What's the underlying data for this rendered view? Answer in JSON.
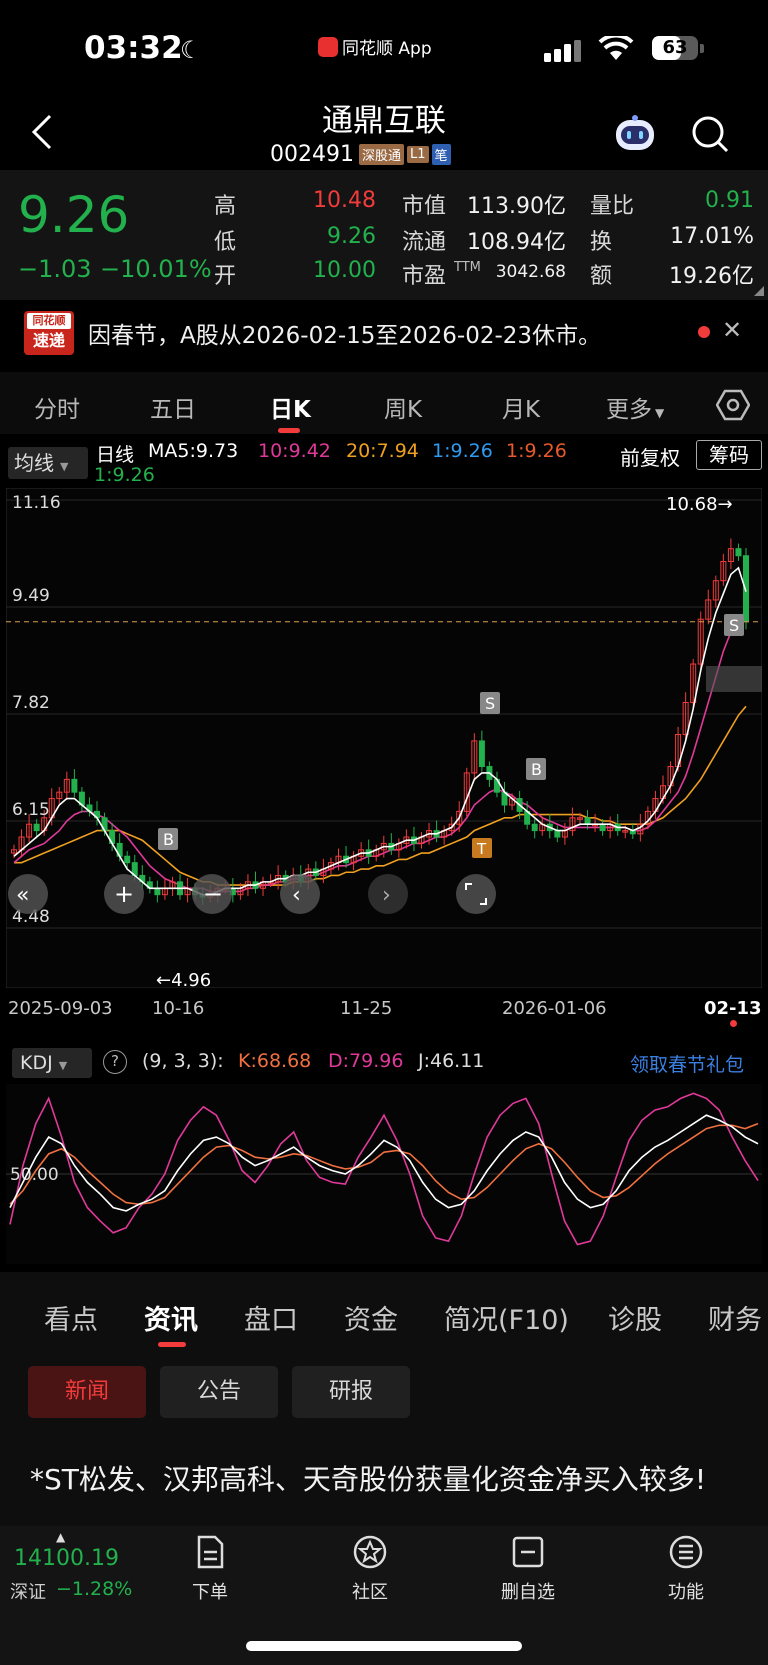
{
  "status": {
    "time": "03:32",
    "app_name": "同花顺 App",
    "battery": "63",
    "battery_level": 0.63
  },
  "nav": {
    "stock_name": "通鼎互联",
    "stock_code": "002491",
    "tags": [
      "深股通",
      "L1",
      "笔"
    ]
  },
  "quote": {
    "price": "9.26",
    "change": "−1.03",
    "change_pct": "−10.01%",
    "high_label": "高",
    "high": "10.48",
    "low_label": "低",
    "low": "9.26",
    "open_label": "开",
    "open": "10.00",
    "mcap_label": "市值",
    "mcap": "113.90亿",
    "float_label": "流通",
    "float": "108.94亿",
    "pe_label": "市盈",
    "pe_sup": "TTM",
    "pe": "3042.68",
    "volratio_label": "量比",
    "volratio": "0.91",
    "turnover_label": "换",
    "turnover": "17.01%",
    "amount_label": "额",
    "amount": "19.26亿"
  },
  "notice": {
    "logo_top": "同花顺",
    "logo_bottom": "速递",
    "text": "因春节，A股从2026-02-15至2026-02-23休市。"
  },
  "period_tabs": [
    "分时",
    "五日",
    "日K",
    "周K",
    "月K",
    "更多"
  ],
  "period_active": 2,
  "chart_header": {
    "jx": "均线",
    "day": "日线",
    "ma5": "MA5:9.73",
    "ma10": "10:9.42",
    "ma20": "20:7.94",
    "ma_a": "1:9.26",
    "ma_b": "1:9.26",
    "ma_c": "1:9.26",
    "fq": "前复权",
    "cm": "筹码"
  },
  "chart_data": [
    {
      "type": "candlestick",
      "y_ticks": [
        "11.16",
        "9.49",
        "7.82",
        "6.15",
        "4.48"
      ],
      "ylim": [
        4.48,
        11.16
      ],
      "x_ticks": [
        "2025-09-03",
        "10-16",
        "11-25",
        "2026-01-06",
        "02-13"
      ],
      "max_label": "10.68→",
      "min_label": "←4.96",
      "signal_labels": [
        "S",
        "B",
        "B",
        "S",
        "S",
        "T"
      ],
      "close": [
        5.7,
        5.9,
        6.1,
        6.0,
        6.2,
        6.5,
        6.6,
        6.8,
        6.6,
        6.4,
        6.3,
        6.2,
        6.0,
        5.8,
        5.6,
        5.5,
        5.3,
        5.2,
        5.1,
        5.0,
        5.1,
        5.2,
        5.0,
        5.1,
        5.0,
        4.96,
        5.0,
        5.1,
        5.1,
        5.0,
        5.1,
        5.2,
        5.1,
        5.2,
        5.2,
        5.3,
        5.2,
        5.3,
        5.2,
        5.4,
        5.3,
        5.4,
        5.5,
        5.6,
        5.5,
        5.6,
        5.7,
        5.6,
        5.7,
        5.8,
        5.7,
        5.8,
        5.9,
        5.8,
        5.9,
        6.0,
        5.9,
        6.0,
        6.1,
        6.3,
        6.9,
        7.4,
        7.0,
        6.8,
        6.6,
        6.4,
        6.5,
        6.3,
        6.1,
        6.0,
        6.1,
        6.0,
        5.9,
        6.0,
        6.2,
        6.2,
        6.1,
        6.1,
        6.0,
        6.1,
        6.0,
        6.0,
        5.95,
        6.1,
        6.3,
        6.5,
        6.7,
        7.0,
        7.5,
        8.0,
        8.6,
        9.3,
        9.6,
        9.9,
        10.2,
        10.4,
        10.29,
        9.26
      ],
      "ma5": [
        5.6,
        5.7,
        5.8,
        5.9,
        6.0,
        6.2,
        6.4,
        6.5,
        6.5,
        6.4,
        6.3,
        6.2,
        6.0,
        5.8,
        5.6,
        5.4,
        5.3,
        5.2,
        5.1,
        5.1,
        5.1,
        5.1,
        5.1,
        5.1,
        5.05,
        5.0,
        5.0,
        5.05,
        5.1,
        5.1,
        5.1,
        5.15,
        5.15,
        5.2,
        5.2,
        5.25,
        5.25,
        5.3,
        5.3,
        5.35,
        5.35,
        5.4,
        5.45,
        5.5,
        5.55,
        5.6,
        5.65,
        5.65,
        5.7,
        5.75,
        5.75,
        5.8,
        5.85,
        5.85,
        5.9,
        5.95,
        5.95,
        6.0,
        6.05,
        6.2,
        6.5,
        6.8,
        6.9,
        6.9,
        6.8,
        6.6,
        6.5,
        6.4,
        6.3,
        6.2,
        6.1,
        6.05,
        6.0,
        6.0,
        6.05,
        6.1,
        6.1,
        6.1,
        6.1,
        6.1,
        6.05,
        6.05,
        6.0,
        6.05,
        6.15,
        6.3,
        6.5,
        6.7,
        7.0,
        7.4,
        7.9,
        8.5,
        9.0,
        9.4,
        9.7,
        10.0,
        10.1,
        9.73
      ],
      "ma10": [
        5.5,
        5.6,
        5.7,
        5.75,
        5.8,
        5.9,
        6.0,
        6.15,
        6.25,
        6.3,
        6.3,
        6.25,
        6.2,
        6.1,
        6.0,
        5.9,
        5.75,
        5.6,
        5.45,
        5.35,
        5.25,
        5.2,
        5.15,
        5.1,
        5.1,
        5.1,
        5.05,
        5.05,
        5.05,
        5.05,
        5.05,
        5.1,
        5.1,
        5.15,
        5.15,
        5.2,
        5.2,
        5.25,
        5.25,
        5.3,
        5.3,
        5.35,
        5.4,
        5.45,
        5.45,
        5.5,
        5.55,
        5.6,
        5.6,
        5.65,
        5.7,
        5.7,
        5.75,
        5.8,
        5.8,
        5.85,
        5.9,
        5.9,
        5.95,
        6.05,
        6.2,
        6.4,
        6.5,
        6.6,
        6.65,
        6.6,
        6.55,
        6.45,
        6.4,
        6.3,
        6.2,
        6.15,
        6.1,
        6.05,
        6.05,
        6.05,
        6.05,
        6.05,
        6.05,
        6.05,
        6.05,
        6.05,
        6.0,
        6.0,
        6.05,
        6.15,
        6.3,
        6.45,
        6.6,
        6.85,
        7.2,
        7.6,
        8.0,
        8.4,
        8.8,
        9.1,
        9.3,
        9.42
      ],
      "ma20": [
        5.5,
        5.5,
        5.55,
        5.6,
        5.65,
        5.7,
        5.75,
        5.8,
        5.85,
        5.9,
        5.95,
        6.0,
        6.0,
        6.0,
        6.0,
        5.95,
        5.9,
        5.85,
        5.75,
        5.65,
        5.55,
        5.45,
        5.35,
        5.3,
        5.25,
        5.2,
        5.2,
        5.15,
        5.15,
        5.15,
        5.15,
        5.15,
        5.15,
        5.15,
        5.15,
        5.15,
        5.15,
        5.2,
        5.2,
        5.2,
        5.25,
        5.25,
        5.3,
        5.3,
        5.35,
        5.35,
        5.4,
        5.4,
        5.45,
        5.45,
        5.5,
        5.55,
        5.55,
        5.6,
        5.65,
        5.65,
        5.7,
        5.75,
        5.8,
        5.85,
        5.9,
        6.0,
        6.05,
        6.1,
        6.15,
        6.2,
        6.2,
        6.25,
        6.25,
        6.25,
        6.25,
        6.25,
        6.25,
        6.25,
        6.25,
        6.25,
        6.2,
        6.2,
        6.15,
        6.15,
        6.1,
        6.1,
        6.1,
        6.1,
        6.1,
        6.15,
        6.2,
        6.3,
        6.4,
        6.5,
        6.65,
        6.8,
        7.0,
        7.2,
        7.4,
        7.6,
        7.8,
        7.94
      ]
    },
    {
      "type": "line",
      "title": "KDJ",
      "params": "(9, 3, 3):",
      "k_label": "K:68.68",
      "d_label": "D:79.96",
      "j_label": "J:46.11",
      "y_tick": "50.00",
      "ylim": [
        0,
        100
      ],
      "series": [
        {
          "name": "K",
          "values": [
            30,
            45,
            60,
            72,
            68,
            55,
            45,
            38,
            30,
            28,
            32,
            35,
            40,
            52,
            62,
            70,
            72,
            68,
            60,
            55,
            58,
            62,
            66,
            60,
            55,
            52,
            50,
            55,
            62,
            70,
            66,
            58,
            45,
            35,
            30,
            32,
            40,
            52,
            62,
            70,
            75,
            72,
            60,
            45,
            35,
            30,
            32,
            40,
            52,
            60,
            66,
            70,
            75,
            80,
            85,
            82,
            78,
            72,
            68
          ]
        },
        {
          "name": "D",
          "values": [
            32,
            40,
            52,
            62,
            65,
            60,
            52,
            45,
            38,
            33,
            32,
            33,
            36,
            44,
            52,
            60,
            66,
            67,
            64,
            60,
            59,
            60,
            62,
            61,
            58,
            55,
            53,
            54,
            57,
            63,
            64,
            62,
            55,
            46,
            39,
            35,
            36,
            42,
            50,
            58,
            65,
            68,
            65,
            57,
            48,
            40,
            36,
            37,
            42,
            49,
            56,
            62,
            67,
            72,
            77,
            79,
            79,
            77,
            79.96
          ]
        },
        {
          "name": "J",
          "values": [
            20,
            55,
            80,
            95,
            72,
            45,
            30,
            22,
            15,
            18,
            30,
            38,
            50,
            70,
            82,
            90,
            85,
            70,
            52,
            45,
            55,
            68,
            75,
            58,
            48,
            45,
            44,
            60,
            72,
            85,
            70,
            50,
            25,
            12,
            10,
            25,
            50,
            72,
            85,
            92,
            95,
            80,
            50,
            22,
            8,
            10,
            25,
            48,
            70,
            82,
            88,
            90,
            95,
            98,
            95,
            88,
            72,
            58,
            46.11
          ]
        }
      ]
    }
  ],
  "kdj": {
    "title": "KDJ",
    "help": "?",
    "params": "(9, 3, 3):",
    "k": "K:68.68",
    "d": "D:79.96",
    "j": "J:46.11",
    "link": "领取春节礼包"
  },
  "content_tabs": [
    "看点",
    "资讯",
    "盘口",
    "资金",
    "简况(F10)",
    "诊股",
    "财务"
  ],
  "content_active": 1,
  "sub_tabs": [
    "新闻",
    "公告",
    "研报"
  ],
  "news_title": "*ST松发、汉邦高科、天奇股份获量化资金净买入较多!",
  "index": {
    "value": "14100.19",
    "name": "深证",
    "pct": "−1.28%"
  },
  "bottom_nav": [
    "下单",
    "社区",
    "删自选",
    "功能"
  ],
  "colors": {
    "up": "#f23b3b",
    "down": "#22b14c",
    "ma5": "#ffffff",
    "ma10": "#e0399a",
    "ma20": "#f0a020",
    "k": "#ffffff",
    "d": "#f07040",
    "j": "#e0399a"
  }
}
